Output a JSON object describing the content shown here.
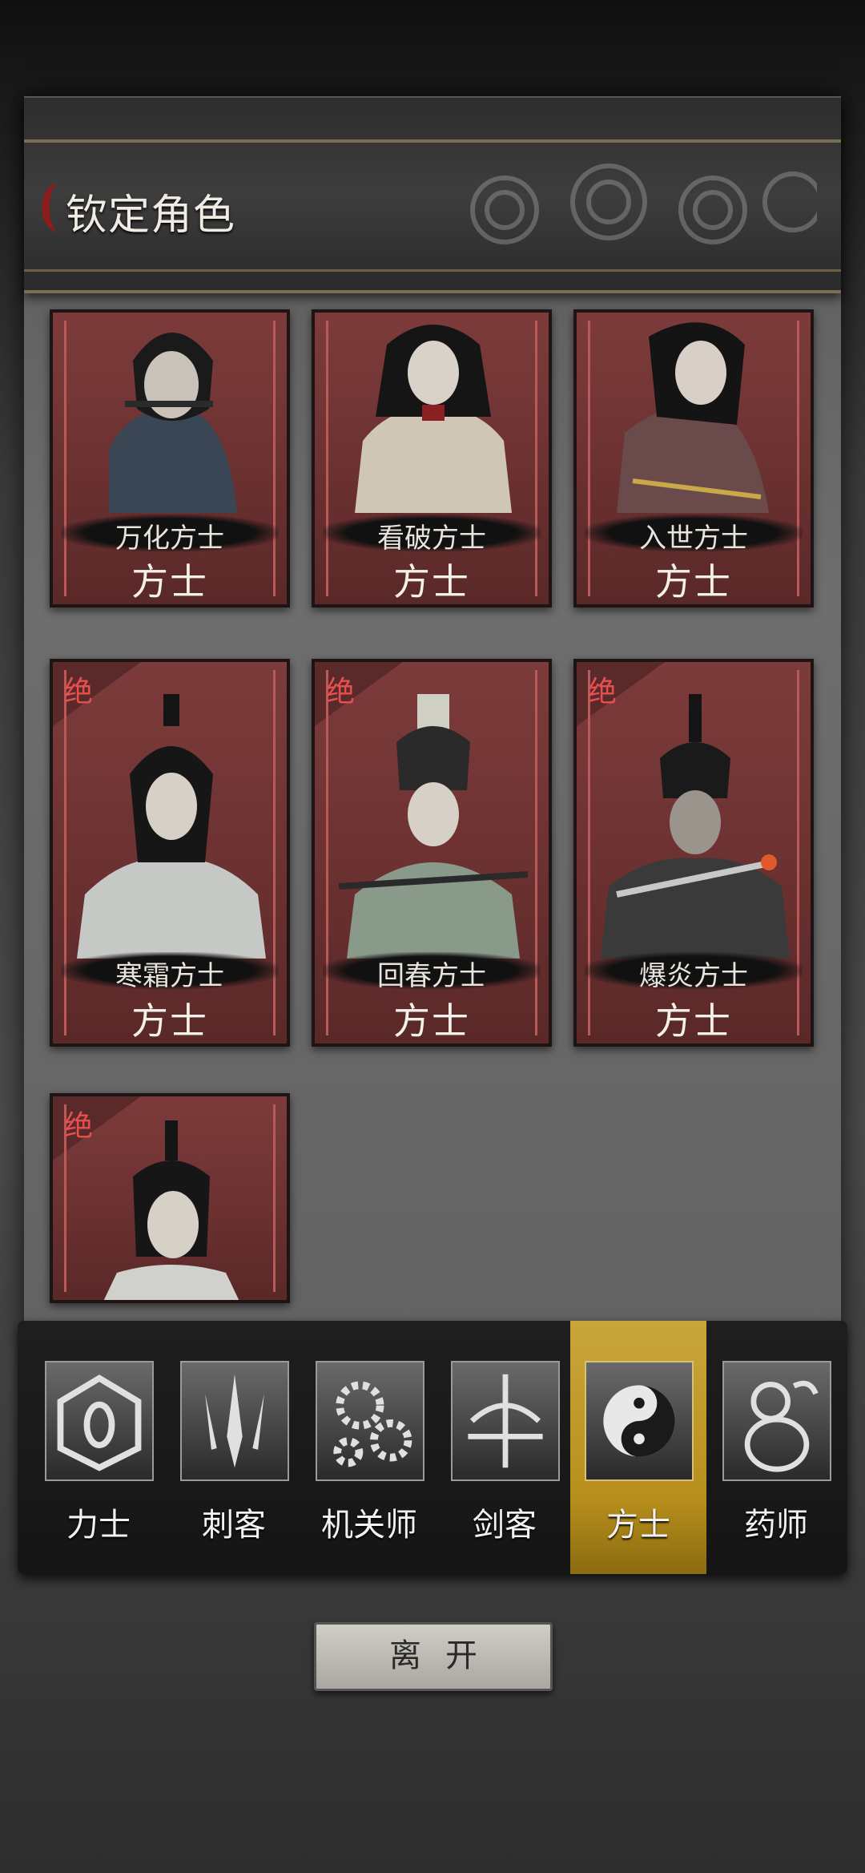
{
  "header": {
    "title": "钦定角色"
  },
  "cards": [
    {
      "name": "万化方士",
      "class": "方士",
      "badge": ""
    },
    {
      "name": "看破方士",
      "class": "方士",
      "badge": ""
    },
    {
      "name": "入世方士",
      "class": "方士",
      "badge": ""
    },
    {
      "name": "寒霜方士",
      "class": "方士",
      "badge": "绝"
    },
    {
      "name": "回春方士",
      "class": "方士",
      "badge": "绝"
    },
    {
      "name": "爆炎方士",
      "class": "方士",
      "badge": "绝"
    },
    {
      "name": "",
      "class": "",
      "badge": "绝"
    }
  ],
  "tabs": [
    {
      "label": "力士",
      "icon": "shield-eye-icon"
    },
    {
      "label": "刺客",
      "icon": "blades-icon"
    },
    {
      "label": "机关师",
      "icon": "gears-icon"
    },
    {
      "label": "剑客",
      "icon": "sword-icon"
    },
    {
      "label": "方士",
      "icon": "yin-yang-icon",
      "active": true
    },
    {
      "label": "药师",
      "icon": "gourd-icon"
    }
  ],
  "footer": {
    "leave_label": "离开"
  },
  "colors": {
    "card_red": "#7d3b3b",
    "active_tab": "#c9a63a",
    "badge_red": "#e85050"
  }
}
